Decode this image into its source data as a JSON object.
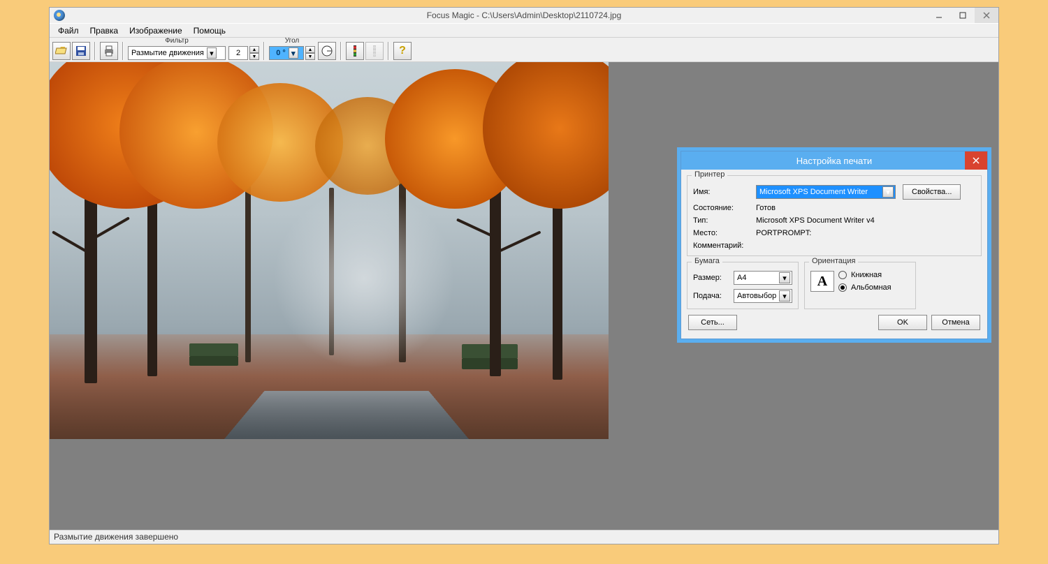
{
  "titlebar": {
    "title": "Focus Magic - C:\\Users\\Admin\\Desktop\\2110724.jpg"
  },
  "menu": {
    "file": "Файл",
    "edit": "Правка",
    "image": "Изображение",
    "help": "Помощь"
  },
  "toolbar": {
    "filter_label": "Фильтр",
    "filter_value": "Размытие движения",
    "number_value": "2",
    "angle_label": "Угол",
    "angle_value": "0 °"
  },
  "statusbar": {
    "text": "Размытие движения завершено"
  },
  "dialog": {
    "title": "Настройка печати",
    "printer_legend": "Принтер",
    "name_label": "Имя:",
    "name_value": "Microsoft XPS Document Writer",
    "properties_btn": "Свойства...",
    "status_label": "Состояние:",
    "status_value": "Готов",
    "type_label": "Тип:",
    "type_value": "Microsoft XPS Document Writer v4",
    "where_label": "Место:",
    "where_value": "PORTPROMPT:",
    "comment_label": "Комментарий:",
    "paper_legend": "Бумага",
    "size_label": "Размер:",
    "size_value": "A4",
    "source_label": "Подача:",
    "source_value": "Автовыбор",
    "orient_legend": "Ориентация",
    "portrait": "Книжная",
    "landscape": "Альбомная",
    "orient_icon": "A",
    "network_btn": "Сеть...",
    "ok_btn": "OK",
    "cancel_btn": "Отмена"
  }
}
